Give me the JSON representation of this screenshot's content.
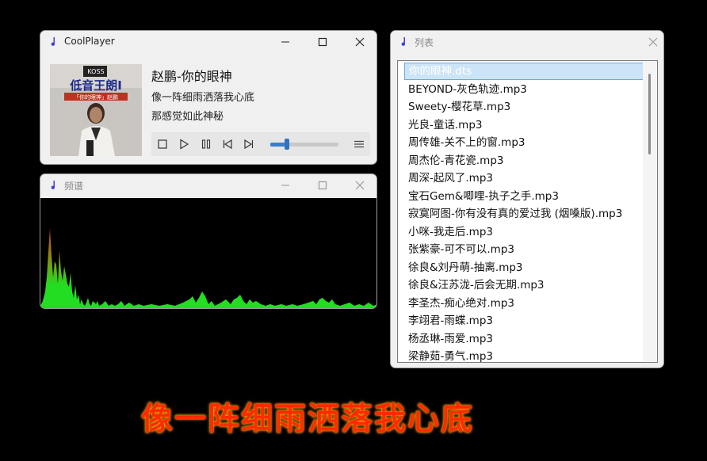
{
  "player": {
    "title": "CoolPlayer",
    "song_title": "赵鹏-你的眼神",
    "lyric_line_1": "像一阵细雨洒落我心底",
    "lyric_line_2": "那感觉如此神秘",
    "cover_art_text": "低音王朗I",
    "cover_art_subtext": "「你的眼神」赵鹏",
    "progress": 0.24
  },
  "spectrum": {
    "title": "频谱"
  },
  "playlist": {
    "title": "列表",
    "items": [
      "你的眼神.dts",
      "BEYOND-灰色轨迹.mp3",
      "Sweety-樱花草.mp3",
      "光良-童话.mp3",
      "周传雄-关不上的窗.mp3",
      "周杰伦-青花瓷.mp3",
      "周深-起风了.mp3",
      "宝石Gem&唧哩-执子之手.mp3",
      "寂寞阿图-你有没有真的爱过我 (烟嗓版).mp3",
      "小咪-我走后.mp3",
      "张紫豪-可不可以.mp3",
      "徐良&刘丹萌-抽离.mp3",
      "徐良&汪苏泷-后会无期.mp3",
      "李圣杰-痴心绝对.mp3",
      "李翊君-雨蝶.mp3",
      "杨丞琳-雨爱.mp3",
      "梁静茹-勇气.mp3"
    ],
    "selected_index": 0
  },
  "desktop_lyric": "像一阵细雨洒落我心底",
  "colors": {
    "accent": "#3a7fcf",
    "lyric_red": "#ff2a00",
    "spectrum_green": "#22dd22"
  }
}
